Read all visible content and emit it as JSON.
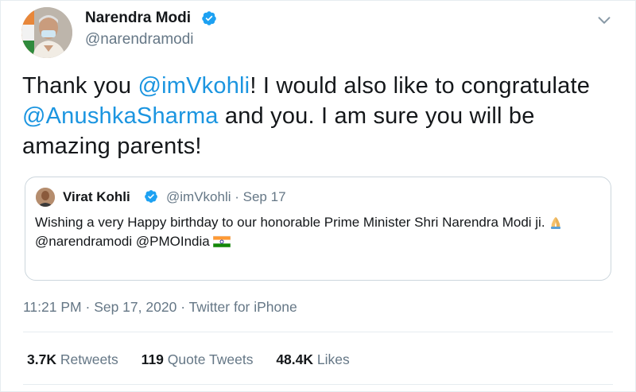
{
  "author": {
    "name": "Narendra Modi",
    "handle": "@narendramodi"
  },
  "tweet": {
    "segments": [
      {
        "text": "Thank you ",
        "mention": false
      },
      {
        "text": "@imVkohli",
        "mention": true
      },
      {
        "text": "! I would also like to congratulate ",
        "mention": false
      },
      {
        "text": "@AnushkaSharma",
        "mention": true
      },
      {
        "text": " and you. I am sure you will be amazing parents!",
        "mention": false
      }
    ]
  },
  "quoted_tweet": {
    "name": "Virat Kohli",
    "handle": "@imVkohli",
    "date": "Sep 17",
    "line1": "Wishing a very Happy birthday to our honorable Prime Minister Shri Narendra Modi ji.",
    "line2": "@narendramodi @PMOIndia"
  },
  "meta": {
    "time": "11:21 PM",
    "date": "Sep 17, 2020",
    "source": "Twitter for iPhone"
  },
  "stats": {
    "retweets_count": "3.7K",
    "retweets_label": "Retweets",
    "quotes_count": "119",
    "quotes_label": "Quote Tweets",
    "likes_count": "48.4K",
    "likes_label": "Likes"
  },
  "colors": {
    "accent": "#1b95e0",
    "secondary_text": "#657786",
    "verified": "#1da1f2"
  },
  "icons": [
    "verified-badge-icon",
    "chevron-down-icon",
    "folded-hands-emoji",
    "india-flag-emoji"
  ]
}
